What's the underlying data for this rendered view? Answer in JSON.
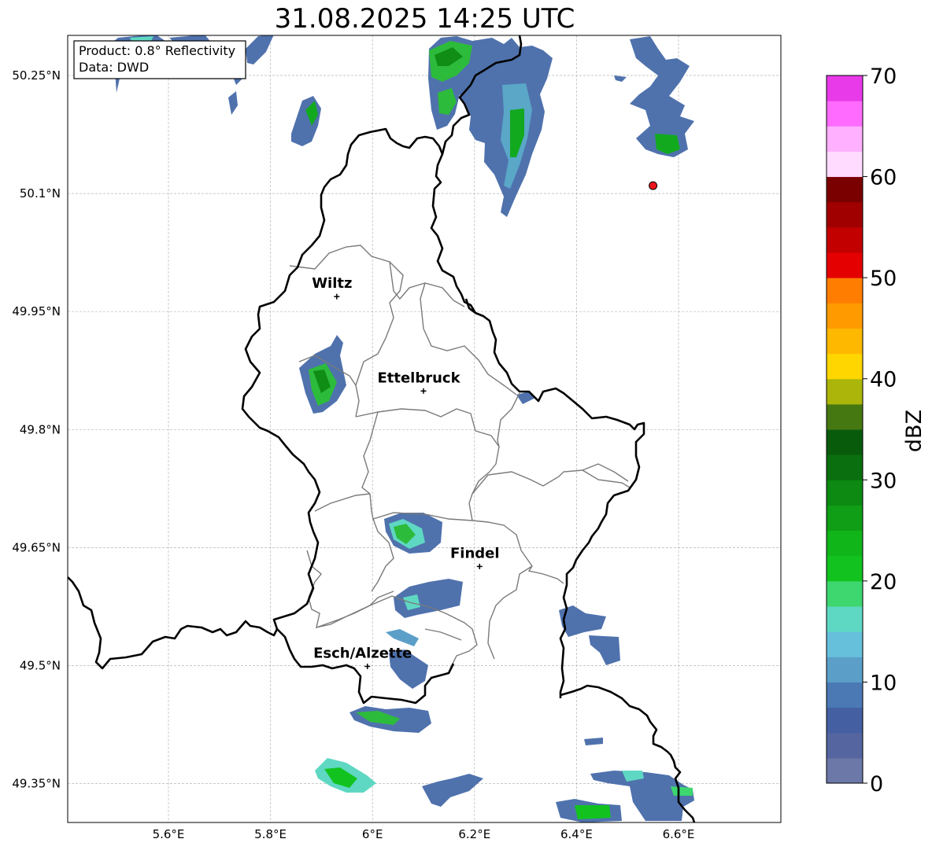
{
  "title": "31.08.2025 14:25 UTC",
  "info_box": {
    "product_line": "Product: 0.8° Reflectivity",
    "data_line": "Data: DWD"
  },
  "map": {
    "lon_ticks": [
      "5.6°E",
      "5.8°E",
      "6°E",
      "6.2°E",
      "6.4°E",
      "6.6°E"
    ],
    "lat_ticks": [
      "50.25°N",
      "50.1°N",
      "49.95°N",
      "49.8°N",
      "49.65°N",
      "49.5°N",
      "49.35°N"
    ],
    "lon_tick_values": [
      5.6,
      5.8,
      6.0,
      6.2,
      6.4,
      6.6
    ],
    "lat_tick_values": [
      50.25,
      50.1,
      49.95,
      49.8,
      49.65,
      49.5,
      49.35
    ],
    "grid": true,
    "cities": [
      {
        "name": "Wiltz",
        "lon": 5.93,
        "lat": 49.969
      },
      {
        "name": "Ettelbruck",
        "lon": 6.1,
        "lat": 49.849
      },
      {
        "name": "Findel",
        "lon": 6.21,
        "lat": 49.626
      },
      {
        "name": "Esch/Alzette",
        "lon": 5.99,
        "lat": 49.499
      }
    ],
    "marker": {
      "lon": 6.55,
      "lat": 50.11,
      "color": "#e8161b"
    }
  },
  "colorbar": {
    "label": "dBZ",
    "tick_labels": [
      "0",
      "10",
      "20",
      "30",
      "40",
      "50",
      "60",
      "70"
    ],
    "tick_values": [
      0,
      10,
      20,
      30,
      40,
      50,
      60,
      70
    ],
    "colors": [
      "#6b78a8",
      "#5465a0",
      "#4560a2",
      "#4a79b4",
      "#5b9fc9",
      "#66c0dc",
      "#5fd8c3",
      "#3dd66f",
      "#12c31f",
      "#10b51a",
      "#0f9e15",
      "#0c8a12",
      "#0a6f0e",
      "#095b0c",
      "#467812",
      "#abb50a",
      "#ffd600",
      "#ffb800",
      "#ff9a00",
      "#ff7d00",
      "#e40000",
      "#c20000",
      "#a10000",
      "#7a0000",
      "#ffdbff",
      "#ffb0ff",
      "#ff6bff",
      "#e83ae8"
    ]
  }
}
